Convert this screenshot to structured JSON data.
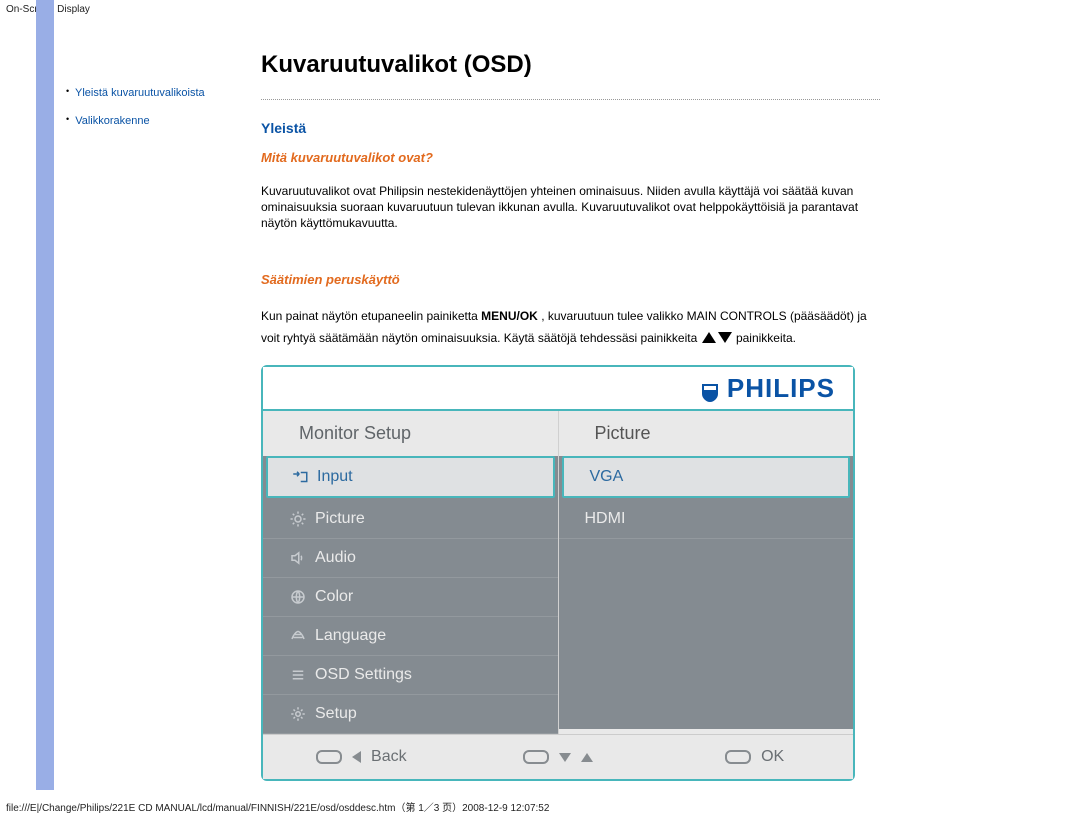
{
  "header_text": "On-Screen Display",
  "sidebar": {
    "items": [
      {
        "label": "Yleistä kuvaruutuvalikoista"
      },
      {
        "label": "Valikkorakenne"
      }
    ]
  },
  "page_title": "Kuvaruutuvalikot (OSD)",
  "section_general_heading": "Yleistä",
  "section_what_heading": "Mitä kuvaruutuvalikot ovat?",
  "para_what": "Kuvaruutuvalikot ovat Philipsin nestekidenäyttöjen yhteinen ominaisuus. Niiden avulla käyttäjä voi säätää kuvan ominaisuuksia suoraan kuvaruutuun tulevan ikkunan avulla. Kuvaruutuvalikot ovat helppokäyttöisiä ja parantavat näytön käyttömukavuutta.",
  "section_controls_heading": "Säätimien peruskäyttö",
  "para_controls_pre": "Kun painat näytön etupaneelin painiketta ",
  "para_controls_menu": "MENU/OK",
  "para_controls_mid": " , kuvaruutuun tulee valikko MAIN CONTROLS (pääsäädöt) ja voit ryhtyä säätämään näytön ominaisuuksia. Käytä säätöjä tehdessäsi painikkeita ",
  "para_controls_post": " painikkeita.",
  "osd": {
    "brand": "PHILIPS",
    "left_header": "Monitor Setup",
    "right_header": "Picture",
    "menu_items": [
      {
        "name": "input",
        "label": "Input",
        "selected": true,
        "icon": "input-icon"
      },
      {
        "name": "picture",
        "label": "Picture",
        "selected": false,
        "icon": "brightness-icon"
      },
      {
        "name": "audio",
        "label": "Audio",
        "selected": false,
        "icon": "speaker-icon"
      },
      {
        "name": "color",
        "label": "Color",
        "selected": false,
        "icon": "globe-icon"
      },
      {
        "name": "language",
        "label": "Language",
        "selected": false,
        "icon": "language-icon"
      },
      {
        "name": "osdsettings",
        "label": "OSD Settings",
        "selected": false,
        "icon": "list-icon"
      },
      {
        "name": "setup",
        "label": "Setup",
        "selected": false,
        "icon": "gear-icon"
      }
    ],
    "right_items": [
      {
        "name": "vga",
        "label": "VGA",
        "selected": true
      },
      {
        "name": "hdmi",
        "label": "HDMI",
        "selected": false
      }
    ],
    "bottom": {
      "back": "Back",
      "ok": "OK"
    }
  },
  "footer_path": "file:///E|/Change/Philips/221E CD MANUAL/lcd/manual/FINNISH/221E/osd/osddesc.htm（第 1／3 页）2008-12-9 12:07:52"
}
